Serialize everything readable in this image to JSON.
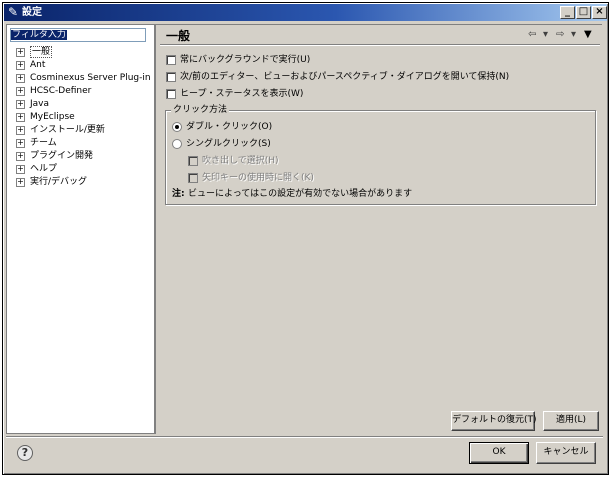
{
  "window": {
    "title": "設定",
    "icon": "settings-icon",
    "controls": {
      "minimize": "_",
      "maximize": "□",
      "close": "×"
    }
  },
  "sidebar": {
    "filter_placeholder": "フィルタ入力",
    "items": [
      {
        "label": "一般",
        "selected": true
      },
      {
        "label": "Ant"
      },
      {
        "label": "Cosminexus Server Plug-in"
      },
      {
        "label": "HCSC-Definer"
      },
      {
        "label": "Java"
      },
      {
        "label": "MyEclipse"
      },
      {
        "label": "インストール/更新"
      },
      {
        "label": "チーム"
      },
      {
        "label": "プラグイン開発"
      },
      {
        "label": "ヘルプ"
      },
      {
        "label": "実行/デバッグ"
      }
    ]
  },
  "page": {
    "title": "一般",
    "checkboxes": [
      {
        "label": "常にバックグラウンドで実行(U)",
        "checked": false
      },
      {
        "label": "次/前のエディター、ビューおよびパースペクティブ・ダイアログを開いて保持(N)",
        "checked": false
      },
      {
        "label": "ヒープ・ステータスを表示(W)",
        "checked": false
      }
    ],
    "click_group": {
      "title": "クリック方法",
      "double_click": "ダブル・クリック(O)",
      "single_click": "シングルクリック(S)",
      "hover_select": "吹き出しで選択(H)",
      "arrow_open": "矢印キーの使用時に開く(K)",
      "note_prefix": "注:",
      "note_text": "ビューによってはこの設定が有効でない場合があります"
    },
    "buttons": {
      "restore_defaults": "デフォルトの復元(T)",
      "apply": "適用(L)"
    }
  },
  "dialog_buttons": {
    "ok": "OK",
    "cancel": "キャンセル"
  },
  "colors": {
    "titlebar_start": "#0a246a",
    "titlebar_end": "#a6caf0",
    "face": "#d4d0c8"
  }
}
